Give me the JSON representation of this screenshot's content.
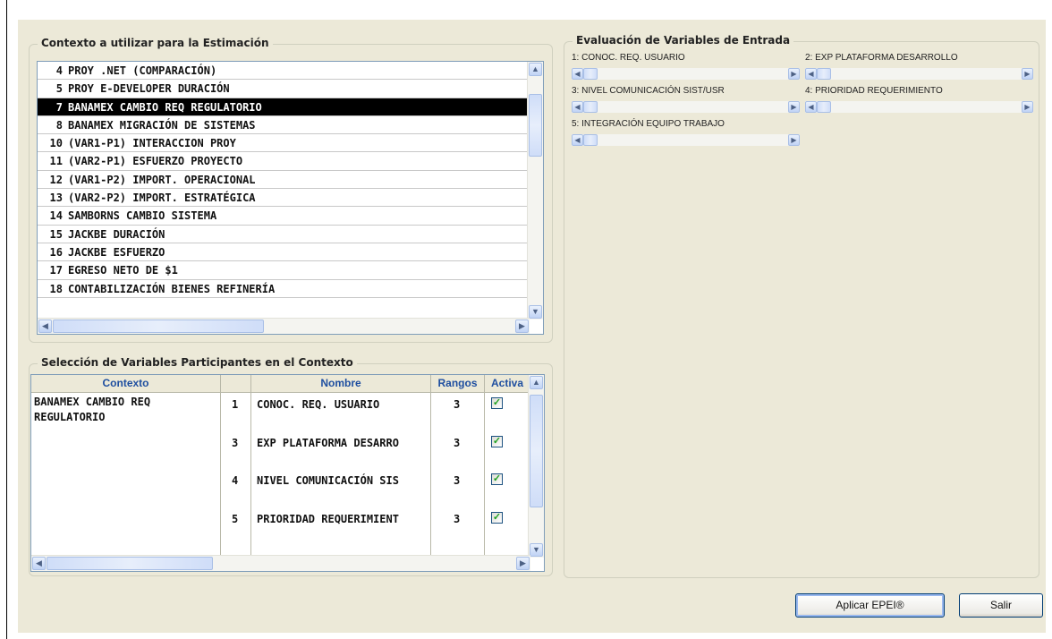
{
  "context_group": {
    "title": "Contexto a utilizar para la Estimación",
    "items": [
      {
        "num": "4",
        "label": "PROY .NET (COMPARACIÓN)",
        "selected": false
      },
      {
        "num": "5",
        "label": "PROY E-DEVELOPER DURACIÓN",
        "selected": false
      },
      {
        "num": "7",
        "label": "BANAMEX CAMBIO REQ REGULATORIO",
        "selected": true
      },
      {
        "num": "8",
        "label": "BANAMEX MIGRACIÓN DE SISTEMAS",
        "selected": false
      },
      {
        "num": "10",
        "label": "(VAR1-P1) INTERACCION PROY",
        "selected": false
      },
      {
        "num": "11",
        "label": "(VAR2-P1) ESFUERZO PROYECTO",
        "selected": false
      },
      {
        "num": "12",
        "label": "(VAR1-P2) IMPORT. OPERACIONAL",
        "selected": false
      },
      {
        "num": "13",
        "label": "(VAR2-P2) IMPORT. ESTRATÉGICA",
        "selected": false
      },
      {
        "num": "14",
        "label": "SAMBORNS CAMBIO SISTEMA",
        "selected": false
      },
      {
        "num": "15",
        "label": "JACKBE DURACIÓN",
        "selected": false
      },
      {
        "num": "16",
        "label": "JACKBE ESFUERZO",
        "selected": false
      },
      {
        "num": "17",
        "label": "EGRESO NETO DE $1",
        "selected": false
      },
      {
        "num": "18",
        "label": "CONTABILIZACIÓN BIENES REFINERÍA",
        "selected": false
      }
    ]
  },
  "variables_group": {
    "title": "Selección de Variables Participantes en el Contexto",
    "headers": {
      "contexto": "Contexto",
      "nombre": "Nombre",
      "rangos": "Rangos",
      "activa": "Activa"
    },
    "context_name": "BANAMEX CAMBIO REQ\nREGULATORIO",
    "rows": [
      {
        "id": "1",
        "nombre": "CONOC. REQ. USUARIO",
        "rangos": "3",
        "activa": true
      },
      {
        "id": "3",
        "nombre": "EXP PLATAFORMA DESARRO",
        "rangos": "3",
        "activa": true
      },
      {
        "id": "4",
        "nombre": "NIVEL COMUNICACIÓN SIS",
        "rangos": "3",
        "activa": true
      },
      {
        "id": "5",
        "nombre": "PRIORIDAD REQUERIMIENT",
        "rangos": "3",
        "activa": true
      }
    ]
  },
  "evaluation_group": {
    "title": "Evaluación de Variables de Entrada",
    "sliders": [
      {
        "label": "1: CONOC. REQ. USUARIO"
      },
      {
        "label": "2: EXP PLATAFORMA DESARROLLO"
      },
      {
        "label": "3: NIVEL COMUNICACIÓN SIST/USR"
      },
      {
        "label": "4: PRIORIDAD REQUERIMIENTO"
      },
      {
        "label": "5: INTEGRACIÓN EQUIPO TRABAJO"
      }
    ]
  },
  "buttons": {
    "apply": "Aplicar EPEI®",
    "exit": "Salir"
  },
  "icons": {
    "scroll_up": "▲",
    "scroll_down": "▼",
    "scroll_left": "◀",
    "scroll_right": "▶",
    "check": "✓"
  }
}
